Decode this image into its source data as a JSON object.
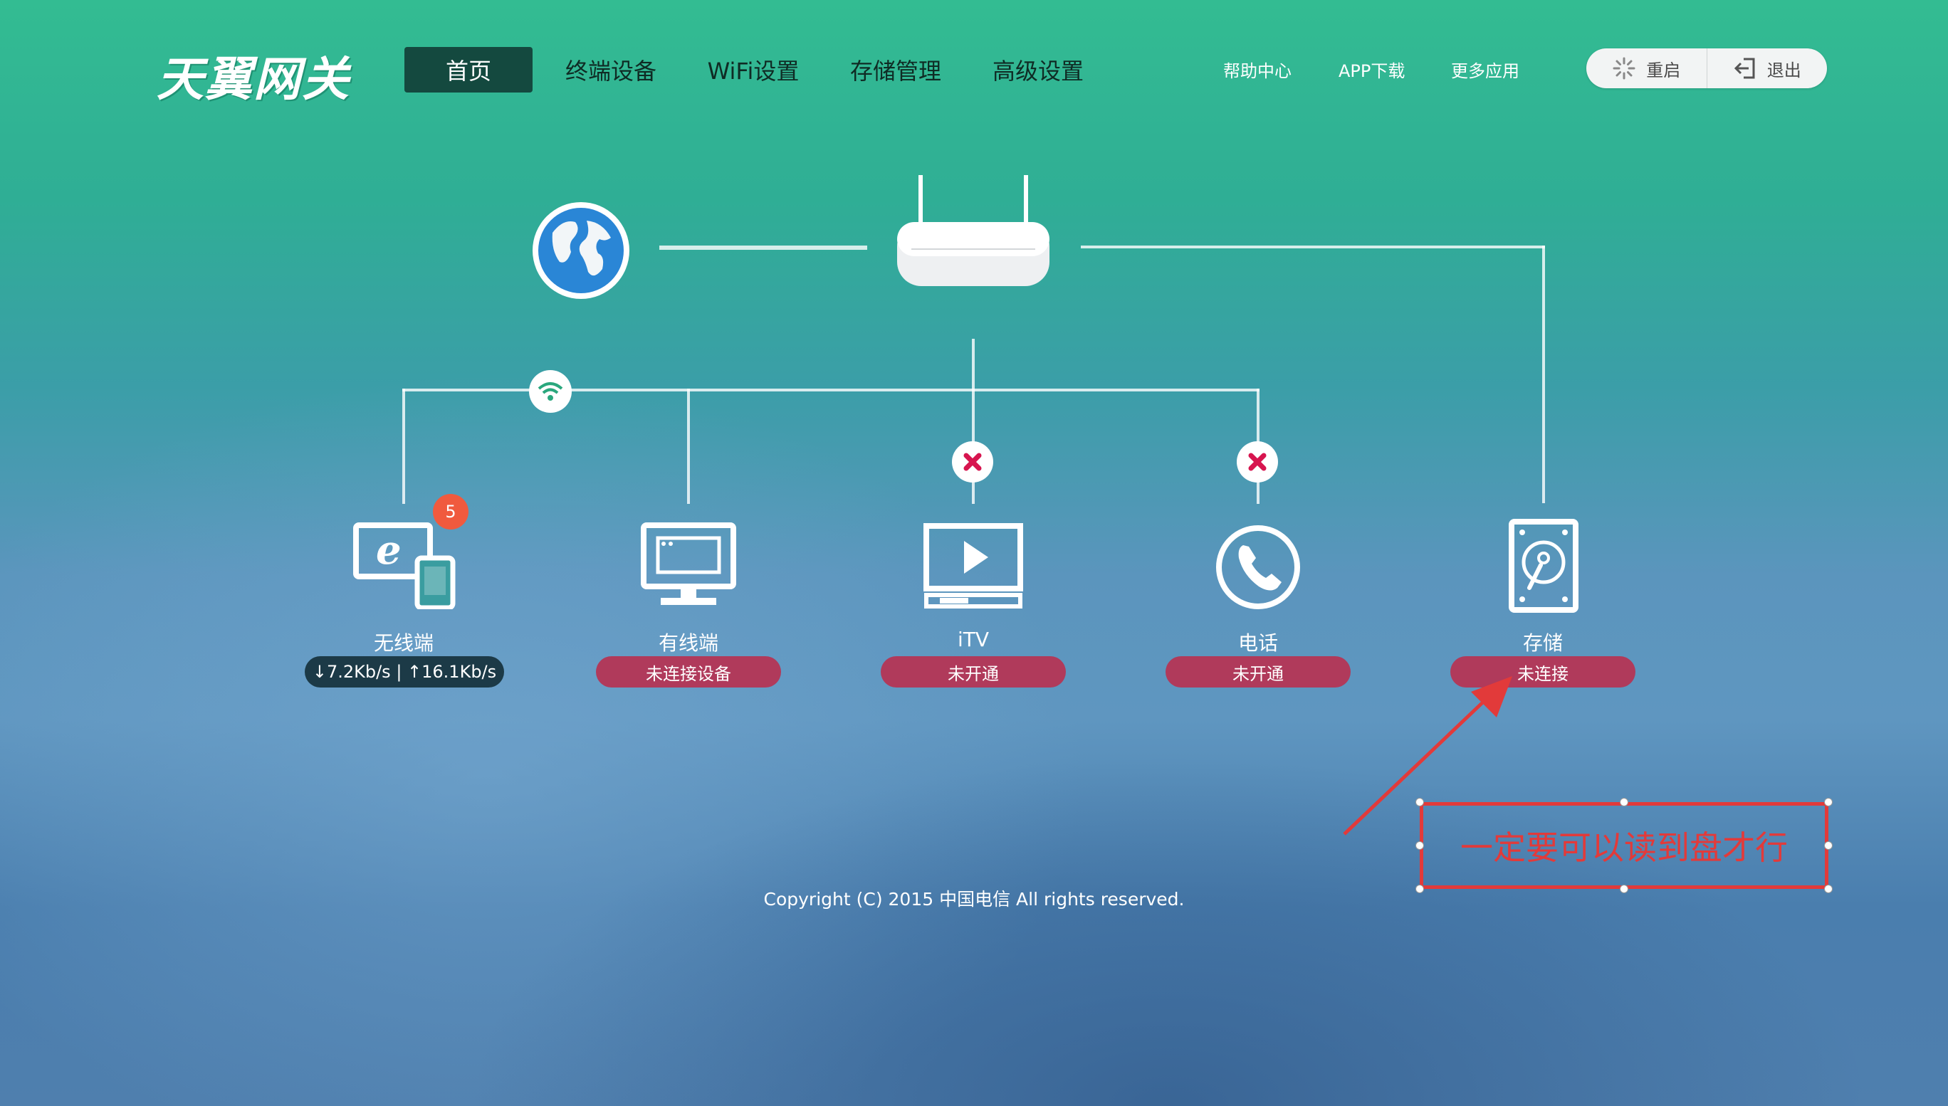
{
  "header": {
    "logo_text": "天翼网关",
    "nav": [
      {
        "label": "首页",
        "active": true
      },
      {
        "label": "终端设备"
      },
      {
        "label": "WiFi设置"
      },
      {
        "label": "存储管理"
      },
      {
        "label": "高级设置"
      }
    ],
    "links": [
      "帮助中心",
      "APP下载",
      "更多应用"
    ],
    "restart_label": "重启",
    "logout_label": "退出"
  },
  "devices": [
    {
      "name": "无线端",
      "status": "↓7.2Kb/s | ↑16.1Kb/s",
      "count": "5",
      "status_style": "dark"
    },
    {
      "name": "有线端",
      "status": "未连接设备",
      "status_style": "red"
    },
    {
      "name": "iTV",
      "status": "未开通",
      "status_style": "red"
    },
    {
      "name": "电话",
      "status": "未开通",
      "status_style": "red"
    },
    {
      "name": "存储",
      "status": "未连接",
      "status_style": "red"
    }
  ],
  "footer": {
    "copyright": "Copyright (C) 2015 中国电信 All rights reserved."
  },
  "annotation": {
    "text": "一定要可以读到盘才行"
  },
  "colors": {
    "accent": "#14493f",
    "status_red": "#b03a5b",
    "annotation_red": "#e23a3a",
    "badge": "#f05a3e"
  }
}
